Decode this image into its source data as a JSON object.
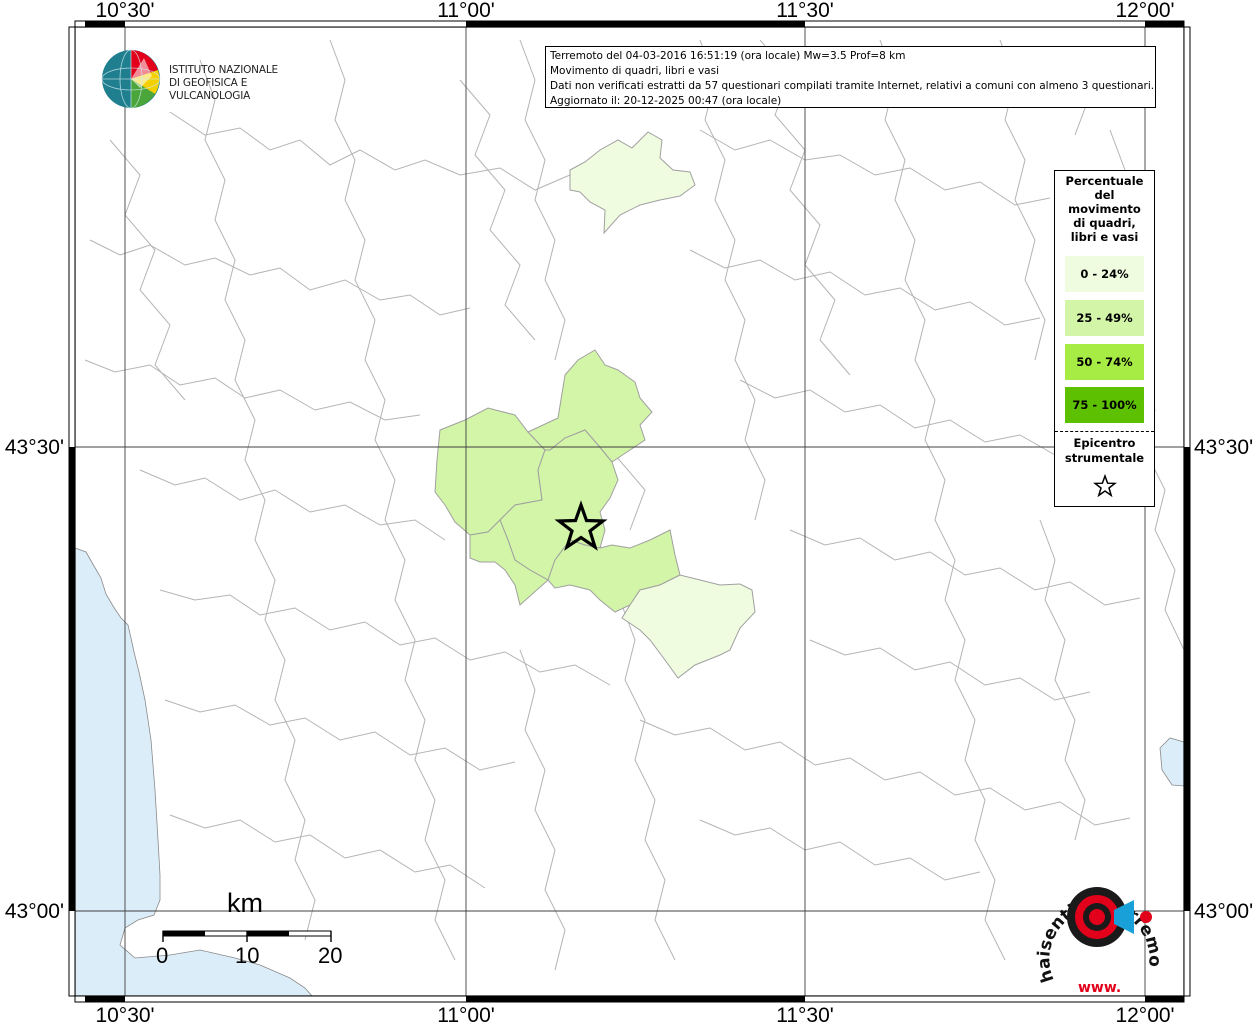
{
  "ticks": {
    "top": [
      "10°30'",
      "11°00'",
      "11°30'",
      "12°00'"
    ],
    "bottom": [
      "10°30'",
      "11°00'",
      "11°30'",
      "12°00'"
    ],
    "left": [
      "43°30'",
      "43°00'"
    ],
    "right": [
      "43°30'",
      "43°00'"
    ]
  },
  "info": {
    "line1": "Terremoto del 04-03-2016 16:51:19 (ora locale) Mw=3.5 Prof=8 km",
    "line2": "Movimento di quadri, libri e vasi",
    "line3": "Dati non verificati estratti da 57 questionari compilati tramite Internet, relativi a comuni con almeno 3 questionari.",
    "line4": "Aggiornato il: 20-12-2025 00:47 (ora locale)"
  },
  "ingv": {
    "line1": "ISTITUTO NAZIONALE",
    "line2": "DI GEOFISICA E VULCANOLOGIA"
  },
  "legend": {
    "title": [
      "Percentuale",
      "del",
      "movimento",
      "di quadri,",
      "libri e vasi"
    ],
    "classes": [
      {
        "label": "0 - 24%",
        "color": "#f0fce0"
      },
      {
        "label": "25 - 49%",
        "color": "#d2f5a8"
      },
      {
        "label": "50 - 74%",
        "color": "#a6ec45"
      },
      {
        "label": "75 - 100%",
        "color": "#5dc000"
      }
    ],
    "epicentre_line1": "Epicentro",
    "epicentre_line2": "strumentale"
  },
  "scale": {
    "unit": "km",
    "labels": [
      "0",
      "10",
      "20"
    ]
  },
  "haisentito": {
    "text": "haisentitoilterremoto.it",
    "prefix": "www."
  },
  "colors": {
    "sea": "#dcedfa",
    "class_0_24": "#f0fce0",
    "class_25_49": "#d2f5a8",
    "border": "#b4b4b4",
    "accent_red": "#e2001a"
  }
}
